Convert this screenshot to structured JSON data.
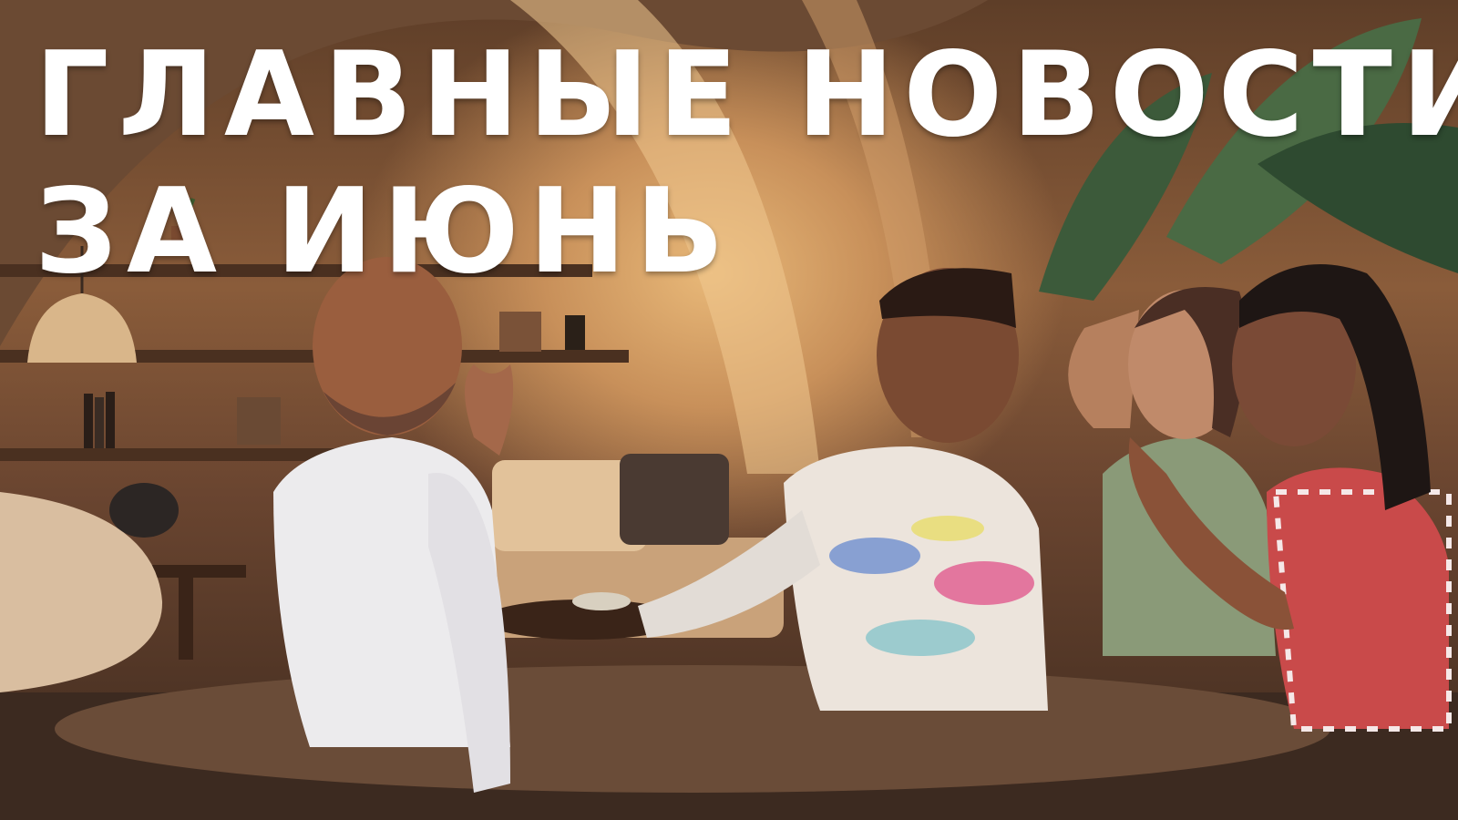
{
  "headline": {
    "line1": "ГЛАВНЫЕ НОВОСТИ",
    "line2": "ЗА ИЮНЬ"
  },
  "colors": {
    "headline_text": "#ffffff",
    "warm_light": "#e8b878",
    "wall_shadow": "#5e3e28"
  }
}
